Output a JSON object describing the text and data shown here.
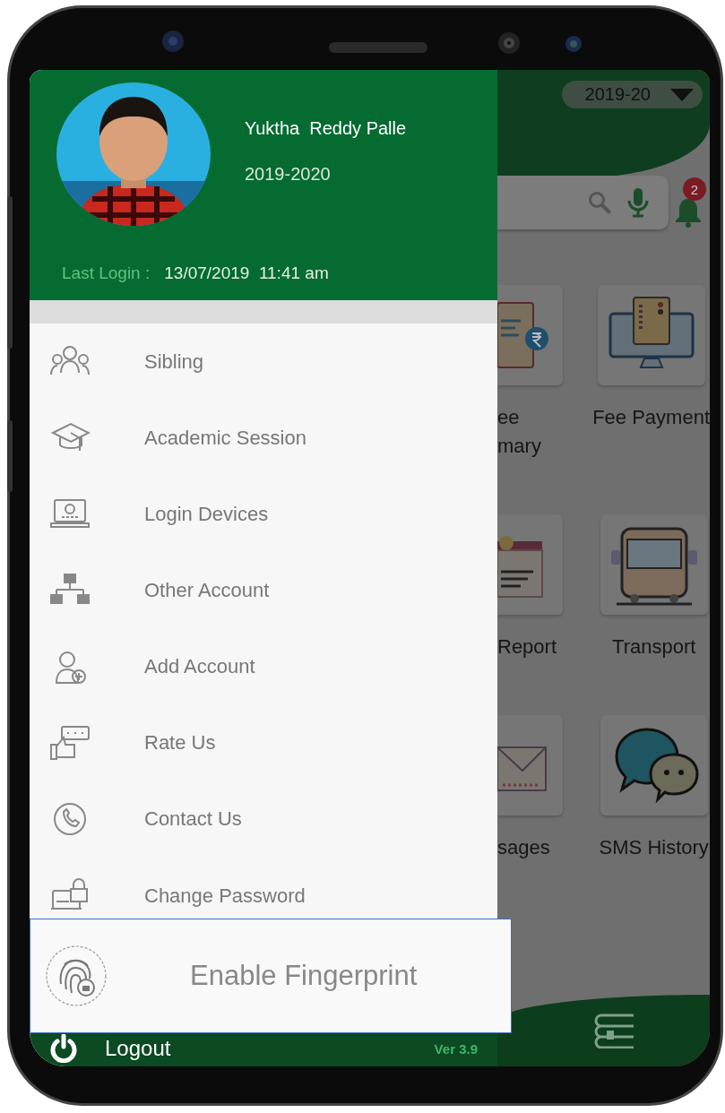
{
  "drawer": {
    "profile": {
      "name": "Yuktha  Reddy Palle",
      "session": "2019-2020",
      "last_login_label": "Last Login :",
      "last_login_value": "13/07/2019  11:41 am"
    },
    "menu_items": [
      {
        "label": "Sibling"
      },
      {
        "label": "Academic Session"
      },
      {
        "label": "Login Devices"
      },
      {
        "label": "Other Account"
      },
      {
        "label": "Add Account"
      },
      {
        "label": "Rate Us"
      },
      {
        "label": "Contact Us"
      },
      {
        "label": "Change Password"
      }
    ],
    "fingerprint_panel": {
      "label": "Enable Fingerprint"
    },
    "footer": {
      "logout": "Logout",
      "version": "Ver 3.9"
    }
  },
  "app_background": {
    "year_dropdown": "2019-20",
    "notification_count": "2",
    "tile_rows": [
      {
        "partial_label": [
          "ee",
          "mary"
        ],
        "label": "Fee Payment"
      },
      {
        "partial_label": [
          "Report"
        ],
        "label": "Transport"
      },
      {
        "partial_label": [
          "sages"
        ],
        "label": "SMS History"
      }
    ]
  }
}
